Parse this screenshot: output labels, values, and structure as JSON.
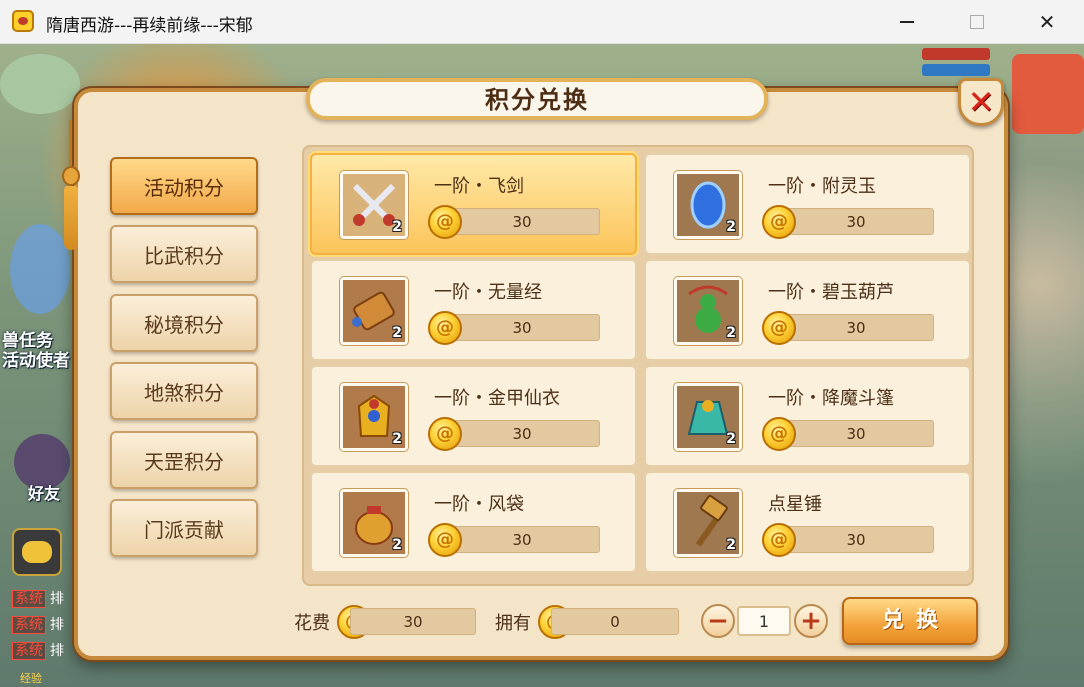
{
  "window": {
    "title": "隋唐西游---再续前缘---宋郁"
  },
  "game_hud": {
    "quest_text": "兽任务",
    "quest_npc": "活动使者",
    "friends_label": "好友",
    "chat": [
      {
        "tag": "系统",
        "text": "排"
      },
      {
        "tag": "系统",
        "text": "排"
      },
      {
        "tag": "系统",
        "text": "排"
      }
    ],
    "bottom_label": "经验"
  },
  "dialog": {
    "title": "积分兑换",
    "close_label": "✕"
  },
  "nav": {
    "items": [
      {
        "label": "活动积分",
        "active": true
      },
      {
        "label": "比武积分",
        "active": false
      },
      {
        "label": "秘境积分",
        "active": false
      },
      {
        "label": "地煞积分",
        "active": false
      },
      {
        "label": "天罡积分",
        "active": false
      },
      {
        "label": "门派贡献",
        "active": false
      }
    ]
  },
  "items": [
    {
      "name": "一阶・飞剑",
      "price": "30",
      "count": "2",
      "icon": "crossed-swords-icon",
      "selected": true
    },
    {
      "name": "一阶・附灵玉",
      "price": "30",
      "count": "2",
      "icon": "blue-jade-icon",
      "selected": false
    },
    {
      "name": "一阶・无量经",
      "price": "30",
      "count": "2",
      "icon": "scroll-icon",
      "selected": false
    },
    {
      "name": "一阶・碧玉葫芦",
      "price": "30",
      "count": "2",
      "icon": "gourd-icon",
      "selected": false
    },
    {
      "name": "一阶・金甲仙衣",
      "price": "30",
      "count": "2",
      "icon": "golden-armor-icon",
      "selected": false
    },
    {
      "name": "一阶・降魔斗篷",
      "price": "30",
      "count": "2",
      "icon": "cloak-icon",
      "selected": false
    },
    {
      "name": "一阶・风袋",
      "price": "30",
      "count": "2",
      "icon": "wind-bag-icon",
      "selected": false
    },
    {
      "name": "点星锤",
      "price": "30",
      "count": "2",
      "icon": "hammer-icon",
      "selected": false
    }
  ],
  "footer": {
    "cost_label": "花费",
    "cost_value": "30",
    "owned_label": "拥有",
    "owned_value": "0",
    "quantity": "1",
    "minus_label": "−",
    "plus_label": "+",
    "exchange_label": "兑换"
  },
  "colors": {
    "accent": "#f3a33a",
    "panel": "#f4e4c8",
    "close_red": "#d8261a"
  }
}
